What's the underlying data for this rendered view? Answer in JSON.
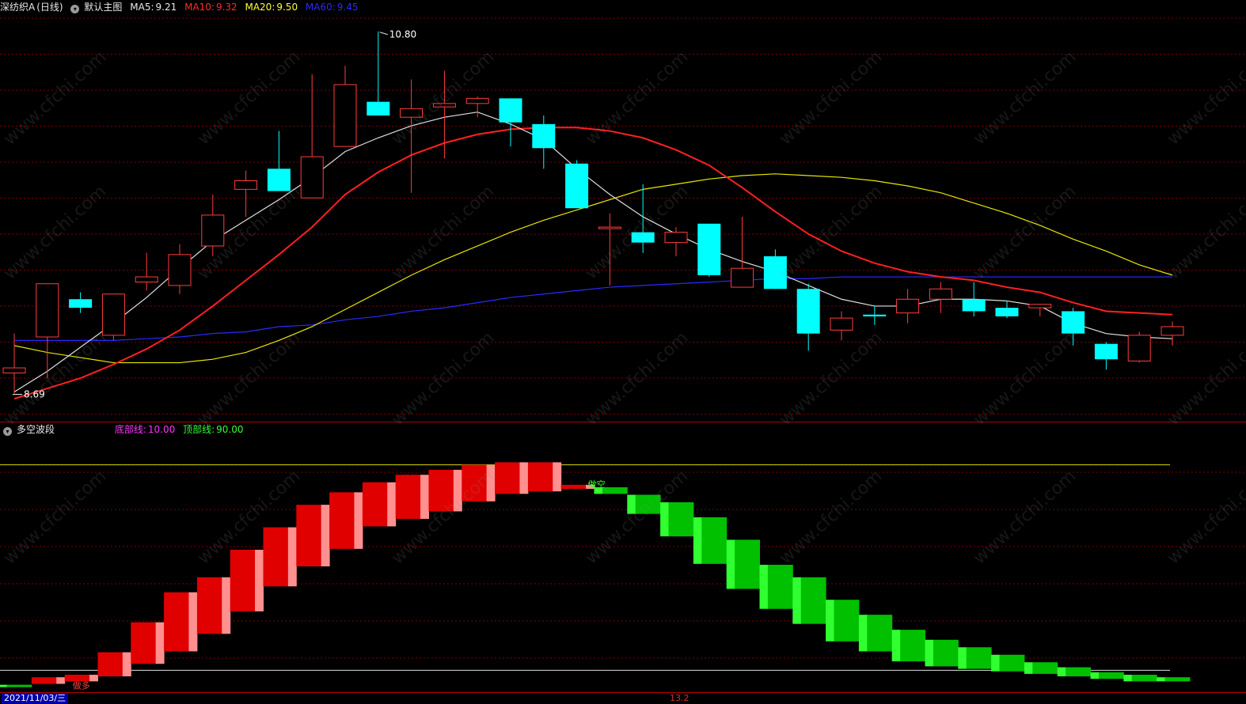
{
  "header": {
    "symbol": "深纺织A",
    "period": "(日线)",
    "template": "默认主图",
    "ma5_label": "MA5:",
    "ma5_value": "9.21",
    "ma10_label": "MA10:",
    "ma10_value": "9.32",
    "ma20_label": "MA20:",
    "ma20_value": "9.50",
    "ma60_label": "MA60:",
    "ma60_value": "9.45"
  },
  "indicator": {
    "name": "多空波段",
    "bottom_label": "底部线:",
    "bottom_value": "10.00",
    "top_label": "顶部线:",
    "top_value": "90.00",
    "signal_buy": "做多",
    "signal_sell": "做空"
  },
  "footer": {
    "date": "2021/11/03/三",
    "center_text": "13.2"
  },
  "watermark": "www.cfchi.com",
  "colors": {
    "background": "#000000",
    "up": "#ff3d3d",
    "down": "#00ffff",
    "ma5": "#e0e0e0",
    "ma10": "#ff2020",
    "ma20": "#e6e600",
    "ma60": "#2a2aff",
    "grid": "#7a0000",
    "bull": "#e00000",
    "bull_light": "#ff9090",
    "bear": "#00c000",
    "bear_light": "#30ff30",
    "label_white": "#ffffff"
  },
  "chart_data": {
    "type": "candlestick",
    "price_range": [
      8.55,
      10.9
    ],
    "annotations": {
      "high": "10.80",
      "low": "8.69"
    },
    "candles": [
      {
        "o": 8.81,
        "h": 9.04,
        "l": 8.69,
        "c": 8.84
      },
      {
        "o": 9.02,
        "h": 9.14,
        "l": 8.78,
        "c": 9.33
      },
      {
        "o": 9.24,
        "h": 9.28,
        "l": 9.16,
        "c": 9.19
      },
      {
        "o": 9.03,
        "h": 9.26,
        "l": 9.0,
        "c": 9.27
      },
      {
        "o": 9.34,
        "h": 9.51,
        "l": 9.29,
        "c": 9.37
      },
      {
        "o": 9.32,
        "h": 9.56,
        "l": 9.27,
        "c": 9.5
      },
      {
        "o": 9.55,
        "h": 9.85,
        "l": 9.49,
        "c": 9.73
      },
      {
        "o": 9.88,
        "h": 9.99,
        "l": 9.72,
        "c": 9.93
      },
      {
        "o": 10.0,
        "h": 10.22,
        "l": 9.87,
        "c": 9.87
      },
      {
        "o": 9.83,
        "h": 10.55,
        "l": 9.83,
        "c": 10.07
      },
      {
        "o": 10.13,
        "h": 10.6,
        "l": 10.13,
        "c": 10.49
      },
      {
        "o": 10.39,
        "h": 10.8,
        "l": 10.35,
        "c": 10.31
      },
      {
        "o": 10.3,
        "h": 10.52,
        "l": 9.86,
        "c": 10.35
      },
      {
        "o": 10.36,
        "h": 10.57,
        "l": 10.06,
        "c": 10.38
      },
      {
        "o": 10.38,
        "h": 10.42,
        "l": 10.3,
        "c": 10.41
      },
      {
        "o": 10.41,
        "h": 10.41,
        "l": 10.13,
        "c": 10.27
      },
      {
        "o": 10.26,
        "h": 10.31,
        "l": 10.0,
        "c": 10.12
      },
      {
        "o": 10.03,
        "h": 10.05,
        "l": 9.77,
        "c": 9.77
      },
      {
        "o": 9.66,
        "h": 9.74,
        "l": 9.32,
        "c": 9.66
      },
      {
        "o": 9.63,
        "h": 9.91,
        "l": 9.51,
        "c": 9.57
      },
      {
        "o": 9.57,
        "h": 9.66,
        "l": 9.49,
        "c": 9.63
      },
      {
        "o": 9.68,
        "h": 9.68,
        "l": 9.37,
        "c": 9.38
      },
      {
        "o": 9.31,
        "h": 9.72,
        "l": 9.31,
        "c": 9.42
      },
      {
        "o": 9.49,
        "h": 9.53,
        "l": 9.31,
        "c": 9.3
      },
      {
        "o": 9.3,
        "h": 9.33,
        "l": 8.94,
        "c": 9.04
      },
      {
        "o": 9.06,
        "h": 9.17,
        "l": 9.0,
        "c": 9.13
      },
      {
        "o": 9.15,
        "h": 9.2,
        "l": 9.09,
        "c": 9.14
      },
      {
        "o": 9.16,
        "h": 9.3,
        "l": 9.1,
        "c": 9.24
      },
      {
        "o": 9.24,
        "h": 9.34,
        "l": 9.16,
        "c": 9.3
      },
      {
        "o": 9.24,
        "h": 9.34,
        "l": 9.14,
        "c": 9.17
      },
      {
        "o": 9.19,
        "h": 9.23,
        "l": 9.13,
        "c": 9.14
      },
      {
        "o": 9.19,
        "h": 9.21,
        "l": 9.14,
        "c": 9.21
      },
      {
        "o": 9.17,
        "h": 9.19,
        "l": 8.97,
        "c": 9.04
      },
      {
        "o": 8.98,
        "h": 8.99,
        "l": 8.83,
        "c": 8.89
      },
      {
        "o": 8.88,
        "h": 9.05,
        "l": 8.87,
        "c": 9.03
      },
      {
        "o": 9.03,
        "h": 9.11,
        "l": 8.97,
        "c": 9.08
      }
    ],
    "ma5": [
      8.7,
      8.82,
      8.96,
      9.1,
      9.25,
      9.42,
      9.58,
      9.7,
      9.82,
      9.95,
      10.1,
      10.18,
      10.25,
      10.3,
      10.33,
      10.26,
      10.17,
      10.0,
      9.85,
      9.72,
      9.62,
      9.53,
      9.46,
      9.4,
      9.32,
      9.24,
      9.2,
      9.2,
      9.24,
      9.24,
      9.23,
      9.2,
      9.1,
      9.04,
      9.02,
      9.01
    ],
    "ma10": [
      8.66,
      8.72,
      8.78,
      8.86,
      8.95,
      9.06,
      9.2,
      9.35,
      9.5,
      9.66,
      9.85,
      9.98,
      10.08,
      10.15,
      10.2,
      10.23,
      10.24,
      10.24,
      10.22,
      10.18,
      10.11,
      10.02,
      9.89,
      9.75,
      9.62,
      9.52,
      9.45,
      9.4,
      9.37,
      9.35,
      9.31,
      9.28,
      9.22,
      9.17,
      9.16,
      9.15
    ],
    "ma20": [
      8.97,
      8.93,
      8.9,
      8.87,
      8.87,
      8.87,
      8.89,
      8.93,
      9.0,
      9.08,
      9.18,
      9.28,
      9.38,
      9.47,
      9.55,
      9.63,
      9.7,
      9.76,
      9.82,
      9.88,
      9.91,
      9.94,
      9.96,
      9.97,
      9.96,
      9.95,
      9.93,
      9.9,
      9.86,
      9.8,
      9.74,
      9.67,
      9.59,
      9.52,
      9.44,
      9.38
    ],
    "ma60": [
      9.0,
      9.0,
      9.0,
      9.0,
      9.01,
      9.02,
      9.04,
      9.05,
      9.08,
      9.09,
      9.12,
      9.14,
      9.17,
      9.19,
      9.22,
      9.25,
      9.27,
      9.29,
      9.31,
      9.32,
      9.33,
      9.34,
      9.35,
      9.36,
      9.36,
      9.37,
      9.37,
      9.37,
      9.37,
      9.37,
      9.37,
      9.37,
      9.37,
      9.37,
      9.37,
      9.37
    ],
    "oscillator": {
      "range": [
        0,
        100
      ],
      "bottom_line": 10,
      "top_line": 90,
      "bars": [
        {
          "lo": 2,
          "hi": 2,
          "side": "bear"
        },
        {
          "lo": 3,
          "hi": 5,
          "side": "bull"
        },
        {
          "lo": 4,
          "hi": 6,
          "side": "bull"
        },
        {
          "lo": 6,
          "hi": 15,
          "side": "bull"
        },
        {
          "lo": 11,
          "hi": 27,
          "side": "bull"
        },
        {
          "lo": 16,
          "hi": 39,
          "side": "bull"
        },
        {
          "lo": 23,
          "hi": 45,
          "side": "bull"
        },
        {
          "lo": 32,
          "hi": 56,
          "side": "bull"
        },
        {
          "lo": 42,
          "hi": 65,
          "side": "bull"
        },
        {
          "lo": 50,
          "hi": 74,
          "side": "bull"
        },
        {
          "lo": 57,
          "hi": 79,
          "side": "bull"
        },
        {
          "lo": 66,
          "hi": 83,
          "side": "bull"
        },
        {
          "lo": 69,
          "hi": 86,
          "side": "bull"
        },
        {
          "lo": 72,
          "hi": 88,
          "side": "bull"
        },
        {
          "lo": 76,
          "hi": 90,
          "side": "bull"
        },
        {
          "lo": 79,
          "hi": 91,
          "side": "bull"
        },
        {
          "lo": 80,
          "hi": 91,
          "side": "bull"
        },
        {
          "lo": 81,
          "hi": 82,
          "side": "bull"
        },
        {
          "lo": 79,
          "hi": 81,
          "side": "bear"
        },
        {
          "lo": 71,
          "hi": 78,
          "side": "bear"
        },
        {
          "lo": 62,
          "hi": 75,
          "side": "bear"
        },
        {
          "lo": 51,
          "hi": 69,
          "side": "bear"
        },
        {
          "lo": 41,
          "hi": 60,
          "side": "bear"
        },
        {
          "lo": 33,
          "hi": 50,
          "side": "bear"
        },
        {
          "lo": 27,
          "hi": 45,
          "side": "bear"
        },
        {
          "lo": 20,
          "hi": 36,
          "side": "bear"
        },
        {
          "lo": 16,
          "hi": 30,
          "side": "bear"
        },
        {
          "lo": 12,
          "hi": 24,
          "side": "bear"
        },
        {
          "lo": 10,
          "hi": 20,
          "side": "bear"
        },
        {
          "lo": 9,
          "hi": 17,
          "side": "bear"
        },
        {
          "lo": 8,
          "hi": 14,
          "side": "bear"
        },
        {
          "lo": 7,
          "hi": 11,
          "side": "bear"
        },
        {
          "lo": 6,
          "hi": 9,
          "side": "bear"
        },
        {
          "lo": 5,
          "hi": 7,
          "side": "bear"
        },
        {
          "lo": 4,
          "hi": 6,
          "side": "bear"
        },
        {
          "lo": 4,
          "hi": 5,
          "side": "bear"
        }
      ]
    }
  }
}
